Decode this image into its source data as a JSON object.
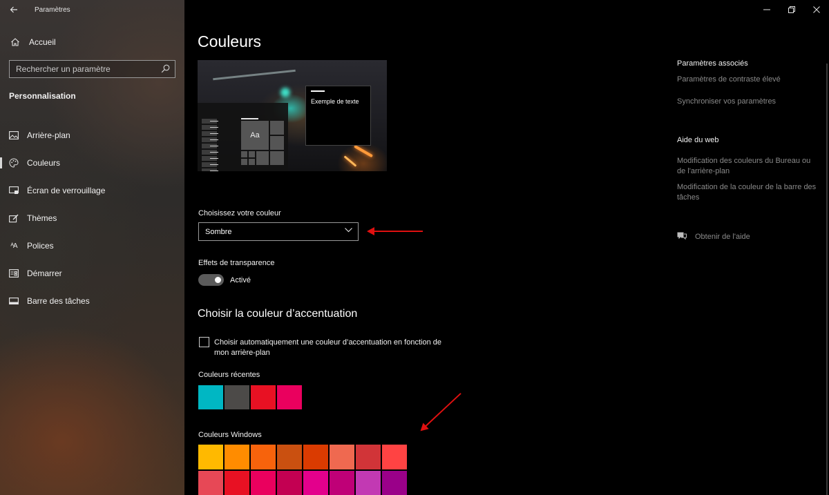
{
  "window": {
    "app_title": "Paramètres",
    "controls": {
      "minimize": "—",
      "maximize": "❐",
      "close": "✕"
    }
  },
  "sidebar": {
    "home_label": "Accueil",
    "search_placeholder": "Rechercher un paramètre",
    "section_title": "Personnalisation",
    "items": [
      {
        "label": "Arrière-plan",
        "icon": "image-icon",
        "active": false
      },
      {
        "label": "Couleurs",
        "icon": "palette-icon",
        "active": true
      },
      {
        "label": "Écran de verrouillage",
        "icon": "lock-screen-icon",
        "active": false
      },
      {
        "label": "Thèmes",
        "icon": "brush-icon",
        "active": false
      },
      {
        "label": "Polices",
        "icon": "font-icon",
        "active": false
      },
      {
        "label": "Démarrer",
        "icon": "start-icon",
        "active": false
      },
      {
        "label": "Barre des tâches",
        "icon": "taskbar-icon",
        "active": false
      }
    ]
  },
  "main": {
    "title": "Couleurs",
    "preview": {
      "sample_text": "Exemple de texte",
      "tile_label": "Aa"
    },
    "choose_color": {
      "label": "Choisissez votre couleur",
      "value": "Sombre"
    },
    "transparency": {
      "label": "Effets de transparence",
      "state": "Activé",
      "on": true
    },
    "accent": {
      "title": "Choisir la couleur d’accentuation",
      "auto_checkbox_label": "Choisir automatiquement une couleur d’accentuation en fonction de mon arrière-plan",
      "auto_checked": false,
      "recent_label": "Couleurs récentes",
      "recent_colors": [
        "#00b7c3",
        "#4c4a48",
        "#e81123",
        "#ea005e"
      ],
      "windows_label": "Couleurs Windows",
      "windows_colors": [
        "#ffb900",
        "#ff8c00",
        "#f7630c",
        "#ca5010",
        "#da3b01",
        "#ef6950",
        "#d13438",
        "#ff4343",
        "#e74856",
        "#e81123",
        "#ea005e",
        "#c30052",
        "#e3008c",
        "#bf0077",
        "#c239b3",
        "#9a0089"
      ]
    }
  },
  "right": {
    "related_title": "Paramètres associés",
    "related_links": [
      "Paramètres de contraste élevé",
      "Synchroniser vos paramètres"
    ],
    "web_help_title": "Aide du web",
    "web_help_links": [
      "Modification des couleurs du Bureau ou de l'arrière-plan",
      "Modification de la couleur de la barre des tâches"
    ],
    "get_help": "Obtenir de l'aide"
  },
  "annotation_color": "#e01010"
}
